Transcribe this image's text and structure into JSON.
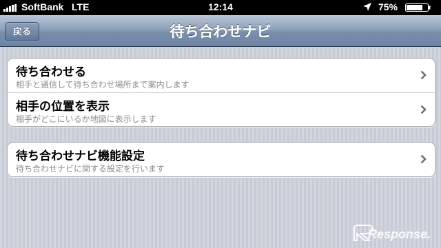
{
  "status_bar": {
    "carrier": "SoftBank",
    "network": "LTE",
    "time": "12:14",
    "battery": "75%",
    "icons": [
      "signal-bars-icon",
      "location-arrow-icon",
      "battery-icon"
    ]
  },
  "nav": {
    "back_label": "戻る",
    "title": "待ち合わせナビ"
  },
  "groups": [
    {
      "rows": [
        {
          "title": "待ち合わせる",
          "subtitle": "相手と通信して待ち合わせ場所まで案内します"
        },
        {
          "title": "相手の位置を表示",
          "subtitle": "相手がどこにいるか地図に表示します"
        }
      ]
    },
    {
      "rows": [
        {
          "title": "待ち合わせナビ機能設定",
          "subtitle": "待ち合わせナビに関する設定を行います"
        }
      ]
    }
  ],
  "watermark": "Response.",
  "colors": {
    "nav_top": "#b9c6d8",
    "nav_bottom": "#6d84a4",
    "subtitle": "#8d8d8d",
    "background_stripe_a": "#d2d6de",
    "background_stripe_b": "#c6cbd5"
  }
}
